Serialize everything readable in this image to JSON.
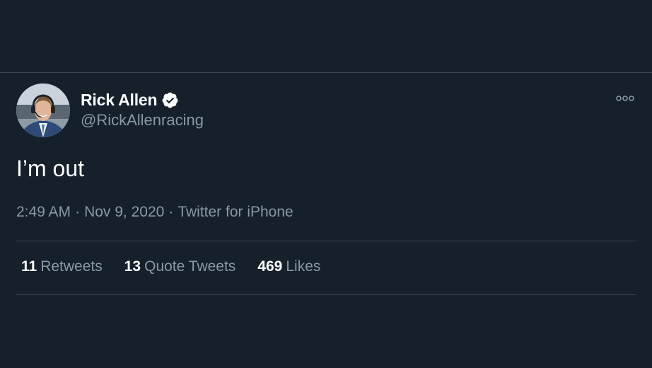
{
  "colors": {
    "background": "#15202b",
    "divider": "#38444d",
    "primary_text": "#ffffff",
    "secondary_text": "#8899a6"
  },
  "author": {
    "display_name": "Rick Allen",
    "handle": "@RickAllenracing",
    "verified_icon": "verified-badge-icon",
    "avatar_icon": "avatar"
  },
  "tweet": {
    "text": "I’m out",
    "time": "2:49 AM",
    "date": "Nov 9, 2020",
    "source": "Twitter for iPhone",
    "separator": "·"
  },
  "stats": {
    "retweets_count": "11",
    "retweets_label": "Retweets",
    "quote_tweets_count": "13",
    "quote_tweets_label": "Quote Tweets",
    "likes_count": "469",
    "likes_label": "Likes"
  },
  "menu": {
    "more_icon": "more-options-icon"
  }
}
